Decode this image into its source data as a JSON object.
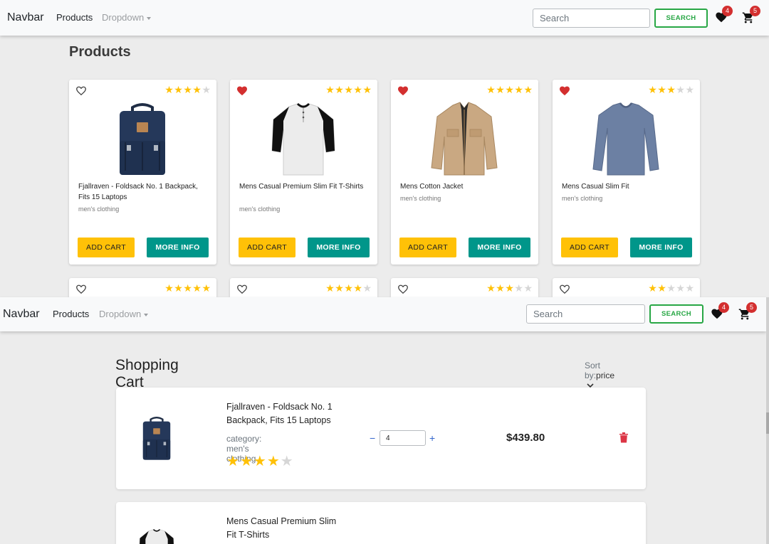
{
  "nav_top": {
    "brand": "Navbar",
    "products": "Products",
    "dropdown": "Dropdown",
    "search_placeholder": "Search",
    "search_button": "SEARCH",
    "wishlist_count": "4",
    "cart_count": "5"
  },
  "products_page": {
    "title": "Products",
    "cards": [
      {
        "title": "Fjallraven - Foldsack No. 1 Backpack, Fits 15 Laptops",
        "category": "men's clothing",
        "rating": 4,
        "favorite": false,
        "image": "backpack",
        "add_label": "ADD CART",
        "info_label": "MORE INFO"
      },
      {
        "title": "Mens Casual Premium Slim Fit T-Shirts",
        "category": "men's clothing",
        "rating": 5,
        "favorite": true,
        "image": "raglan-tshirt",
        "add_label": "ADD CART",
        "info_label": "MORE INFO"
      },
      {
        "title": "Mens Cotton Jacket",
        "category": "men's clothing",
        "rating": 5,
        "favorite": true,
        "image": "jacket",
        "add_label": "ADD CART",
        "info_label": "MORE INFO"
      },
      {
        "title": "Mens Casual Slim Fit",
        "category": "men's clothing",
        "rating": 3,
        "favorite": true,
        "image": "longsleeve-shirt",
        "add_label": "ADD CART",
        "info_label": "MORE INFO"
      }
    ],
    "second_row_ratings": [
      5,
      4,
      3,
      2
    ]
  },
  "nav_bottom": {
    "brand": "Navbar",
    "products": "Products",
    "dropdown": "Dropdown",
    "search_placeholder": "Search",
    "search_button": "SEARCH",
    "wishlist_count": "4",
    "cart_count": "5"
  },
  "cart_page": {
    "title": "Shopping Cart",
    "sort_label": "Sort by:",
    "sort_value": "price",
    "items": [
      {
        "title": "Fjallraven - Foldsack No. 1 Backpack, Fits 15 Laptops",
        "category": "category: men's clothing",
        "rating": 4,
        "quantity": "4",
        "qty_minus": "−",
        "qty_plus": "+",
        "price": "$439.80",
        "image": "backpack"
      },
      {
        "title": "Mens Casual Premium Slim Fit T-Shirts",
        "image": "raglan-tshirt"
      }
    ]
  },
  "colors": {
    "accent_yellow": "#ffc107",
    "accent_teal": "#00968a",
    "search_green": "#28a745",
    "badge_red": "#d32f2f",
    "heart_red": "#d32f2f",
    "delete_red": "#dc3545"
  }
}
